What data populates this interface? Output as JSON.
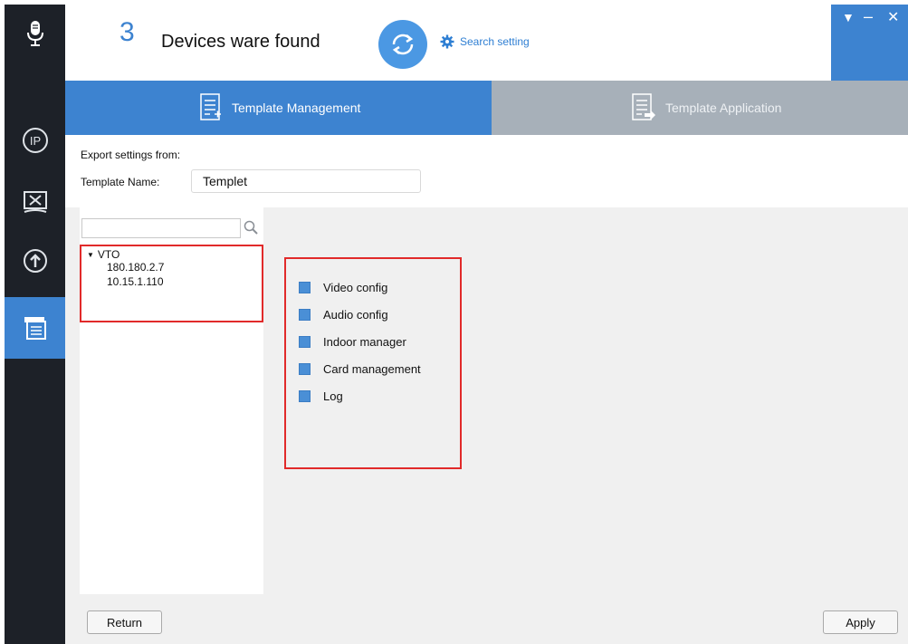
{
  "header": {
    "device_count": "3",
    "device_text": "Devices ware found",
    "search_setting": "Search setting"
  },
  "sidebar": {
    "items": [
      {
        "icon": "microphone-icon"
      },
      {
        "icon": "ip-icon"
      },
      {
        "icon": "tools-icon"
      },
      {
        "icon": "upgrade-icon"
      },
      {
        "icon": "template-icon",
        "active": true
      }
    ]
  },
  "tabs": [
    {
      "label": "Template Management",
      "active": true
    },
    {
      "label": "Template Application",
      "active": false
    }
  ],
  "export": {
    "label": "Export settings from:",
    "template_name_label": "Template Name:",
    "template_name_value": "Templet"
  },
  "tree": {
    "root": "VTO",
    "children": [
      "180.180.2.7",
      "10.15.1.110"
    ]
  },
  "options": [
    {
      "label": "Video config",
      "checked": true
    },
    {
      "label": "Audio config",
      "checked": true
    },
    {
      "label": "Indoor manager",
      "checked": true
    },
    {
      "label": "Card management",
      "checked": true
    },
    {
      "label": "Log",
      "checked": true
    }
  ],
  "footer": {
    "return_label": "Return",
    "apply_label": "Apply"
  },
  "colors": {
    "accent": "#3d83d0",
    "sidebar_bg": "#1d2128",
    "tab_inactive": "#a7b0b9",
    "highlight_border": "#e12a2a"
  }
}
